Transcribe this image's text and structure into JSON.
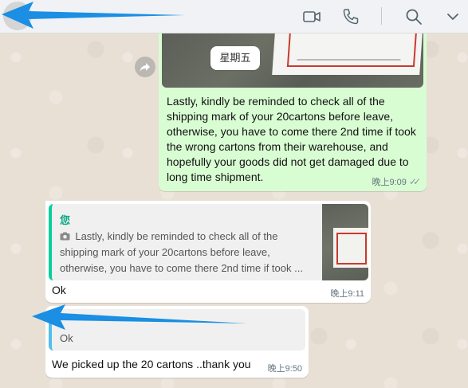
{
  "header": {
    "video_icon": "video-camera-icon",
    "call_icon": "phone-icon",
    "search_icon": "search-icon",
    "menu_icon": "chevron-down-icon"
  },
  "date_chip": "星期五",
  "messages": {
    "outgoing": {
      "text": "Lastly, kindly be reminded to check all of the shipping mark of your 20cartons before leave, otherwise, you have to come there 2nd time if took the wrong cartons from their warehouse, and hopefully your goods did not get damaged due to long time shipment.",
      "time": "晚上9:09",
      "tick": "✓✓"
    },
    "incoming_1": {
      "quote_sender": "您",
      "quote_icon": "camera-icon",
      "quote_text": "Lastly, kindly be reminded to check all of the shipping mark of your 20cartons before leave, otherwise, you have to come there 2nd time if took ...",
      "text": "Ok",
      "time": "晚上9:11"
    },
    "incoming_2": {
      "quote_text": "Ok",
      "text": "We picked up the 20 cartons ..thank you",
      "time": "晚上9:50"
    }
  },
  "colors": {
    "outgoing_bubble": "#d9fdd3",
    "incoming_bubble": "#ffffff",
    "annotation_arrow": "#1a8fe3"
  }
}
